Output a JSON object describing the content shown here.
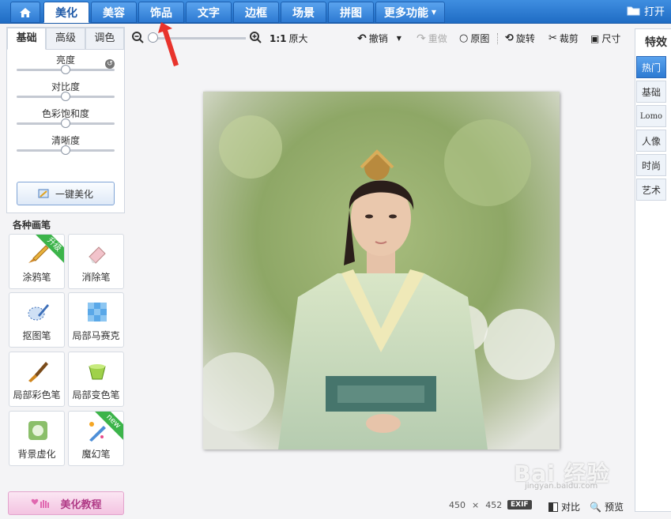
{
  "nav": {
    "tabs": [
      {
        "label": "美化",
        "active": true
      },
      {
        "label": "美容",
        "active": false
      },
      {
        "label": "饰品",
        "active": false
      },
      {
        "label": "文字",
        "active": false
      },
      {
        "label": "边框",
        "active": false
      },
      {
        "label": "场景",
        "active": false
      },
      {
        "label": "拼图",
        "active": false
      },
      {
        "label": "更多功能",
        "active": false
      }
    ],
    "open_label": "打开"
  },
  "left_panel": {
    "subtabs": [
      "基础",
      "高级",
      "调色"
    ],
    "sliders": [
      {
        "label": "亮度",
        "value": 0.5
      },
      {
        "label": "对比度",
        "value": 0.5
      },
      {
        "label": "色彩饱和度",
        "value": 0.5
      },
      {
        "label": "清晰度",
        "value": 0.5
      }
    ],
    "one_key_label": "一键美化",
    "brush_title": "各种画笔",
    "brushes": [
      {
        "label": "涂鸦笔",
        "badge": "升级"
      },
      {
        "label": "消除笔",
        "badge": ""
      },
      {
        "label": "抠图笔",
        "badge": ""
      },
      {
        "label": "局部马赛克",
        "badge": ""
      },
      {
        "label": "局部彩色笔",
        "badge": ""
      },
      {
        "label": "局部变色笔",
        "badge": ""
      },
      {
        "label": "背景虚化",
        "badge": ""
      },
      {
        "label": "魔幻笔",
        "badge": "new"
      }
    ],
    "tutorial_label": "美化教程"
  },
  "toolbar": {
    "ratio": "1:1",
    "original_size": "原大",
    "undo": "撤销",
    "redo": "重做",
    "original": "原图",
    "rotate": "旋转",
    "crop": "裁剪",
    "size": "尺寸"
  },
  "right_panel": {
    "title": "特效",
    "categories": [
      "热门",
      "基础",
      "Lomo",
      "人像",
      "时尚",
      "艺术"
    ]
  },
  "status": {
    "width": "450",
    "times": "×",
    "height": "452",
    "exif": "EXIF",
    "compare": "对比",
    "preview": "预览"
  },
  "watermark": {
    "text": "Bai 经验",
    "sub": "jingyan.baidu.com"
  },
  "colors": {
    "nav_blue": "#2d7ad2",
    "active_category": "#3f8ee0",
    "arrow_red": "#e8332c"
  }
}
